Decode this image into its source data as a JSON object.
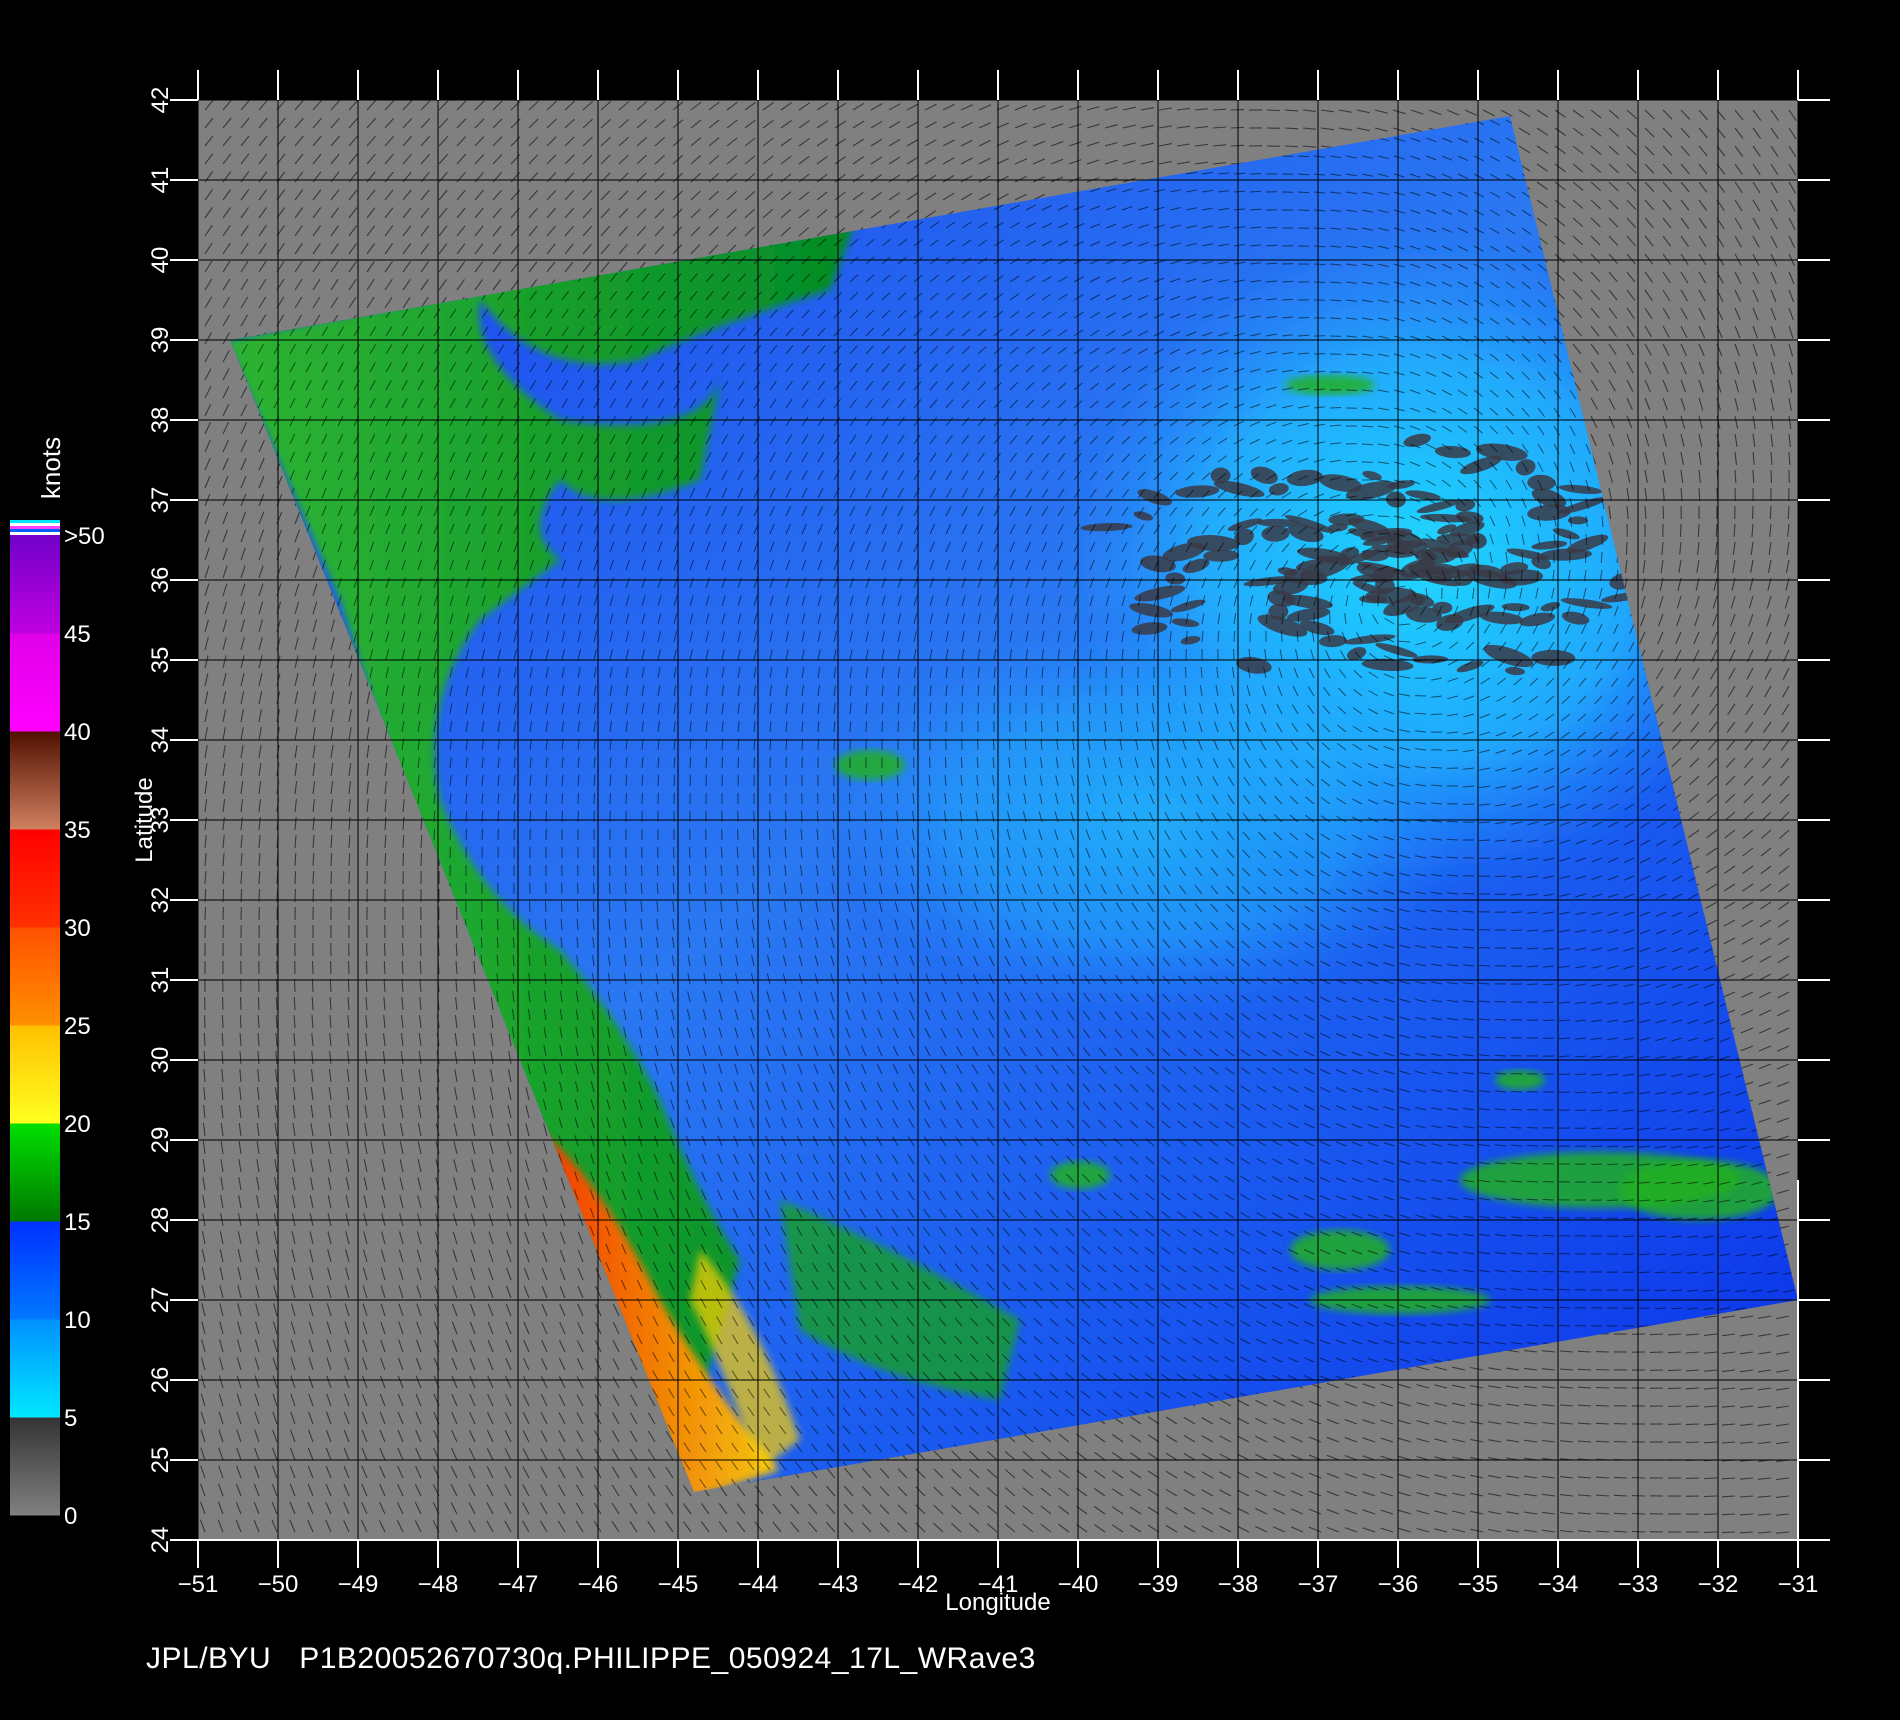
{
  "map": {
    "xlabel": "Longitude",
    "ylabel": "Latitude",
    "lon_range": [
      -51,
      -31
    ],
    "lat_range": [
      24,
      42
    ],
    "lon_ticks": [
      "−51",
      "−50",
      "−49",
      "−48",
      "−47",
      "−46",
      "−45",
      "−44",
      "−43",
      "−42",
      "−41",
      "−40",
      "−39",
      "−38",
      "−37",
      "−36",
      "−35",
      "−34",
      "−33",
      "−32",
      "−31"
    ],
    "lat_ticks": [
      "24",
      "25",
      "26",
      "27",
      "28",
      "29",
      "30",
      "31",
      "32",
      "33",
      "34",
      "35",
      "36",
      "37",
      "38",
      "39",
      "40",
      "41",
      "42"
    ],
    "swath_corners_lonlat": [
      [
        -50.6,
        39.0
      ],
      [
        -34.6,
        41.8
      ],
      [
        -31.0,
        27.0
      ],
      [
        -44.8,
        24.6
      ]
    ],
    "background_color": "#808080",
    "grid": true
  },
  "colorbar": {
    "unit_label": "knots",
    "tick_labels": [
      "0",
      "5",
      "10",
      "15",
      "20",
      "25",
      "30",
      "35",
      "40",
      "45",
      ">50"
    ],
    "segments": [
      {
        "from": 0,
        "to": 5,
        "colors": [
          "#808080",
          "#333333"
        ]
      },
      {
        "from": 5,
        "to": 10,
        "colors": [
          "#00e8ff",
          "#0090ff"
        ]
      },
      {
        "from": 10,
        "to": 15,
        "colors": [
          "#0078ff",
          "#0030ff"
        ]
      },
      {
        "from": 15,
        "to": 20,
        "colors": [
          "#007800",
          "#00e000"
        ]
      },
      {
        "from": 20,
        "to": 25,
        "colors": [
          "#ffff20",
          "#ffc000"
        ]
      },
      {
        "from": 25,
        "to": 30,
        "colors": [
          "#ff9000",
          "#ff5000"
        ]
      },
      {
        "from": 30,
        "to": 35,
        "colors": [
          "#ff3000",
          "#ff0000"
        ]
      },
      {
        "from": 35,
        "to": 40,
        "colors": [
          "#d08060",
          "#501000"
        ]
      },
      {
        "from": 40,
        "to": 45,
        "colors": [
          "#ff00ff",
          "#e000e8"
        ]
      },
      {
        "from": 45,
        "to": 50,
        "colors": [
          "#c000e0",
          "#7000c8"
        ]
      }
    ]
  },
  "footer": {
    "source": "JPL/BYU",
    "filename": "P1B20052670730q.PHILIPPE_050924_17L_WRave3"
  }
}
